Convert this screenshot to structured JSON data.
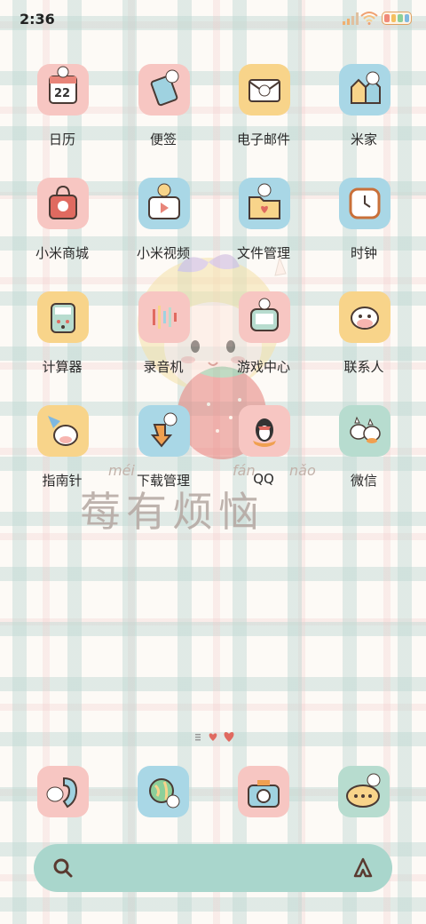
{
  "status_bar": {
    "time": "2:36"
  },
  "apps": [
    {
      "label": "日历",
      "icon": "calendar-icon",
      "badge": "22"
    },
    {
      "label": "便签",
      "icon": "notes-icon"
    },
    {
      "label": "电子邮件",
      "icon": "email-icon"
    },
    {
      "label": "米家",
      "icon": "smart-home-icon"
    },
    {
      "label": "小米商城",
      "icon": "shopping-bag-icon"
    },
    {
      "label": "小米视频",
      "icon": "video-icon"
    },
    {
      "label": "文件管理",
      "icon": "folder-icon"
    },
    {
      "label": "时钟",
      "icon": "clock-icon"
    },
    {
      "label": "计算器",
      "icon": "calculator-icon"
    },
    {
      "label": "录音机",
      "icon": "recorder-icon"
    },
    {
      "label": "游戏中心",
      "icon": "game-center-icon"
    },
    {
      "label": "联系人",
      "icon": "contacts-icon"
    },
    {
      "label": "指南针",
      "icon": "compass-icon"
    },
    {
      "label": "下载管理",
      "icon": "download-icon"
    },
    {
      "label": "QQ",
      "icon": "qq-penguin-icon"
    },
    {
      "label": "微信",
      "icon": "wechat-icon"
    }
  ],
  "wallpaper": {
    "slogan": "莓有烦恼",
    "pinyin": [
      "méi",
      "fán",
      "nǎo"
    ]
  },
  "dock": [
    {
      "icon": "phone-icon"
    },
    {
      "icon": "browser-globe-icon"
    },
    {
      "icon": "camera-icon"
    },
    {
      "icon": "messages-icon"
    }
  ],
  "colors": {
    "search_bar": "#a9d6cc",
    "tile_pink": "#f7c6c2",
    "tile_blue": "#a9d7e6",
    "tile_yellow": "#f8d48a",
    "tile_green": "#b7dccf"
  }
}
